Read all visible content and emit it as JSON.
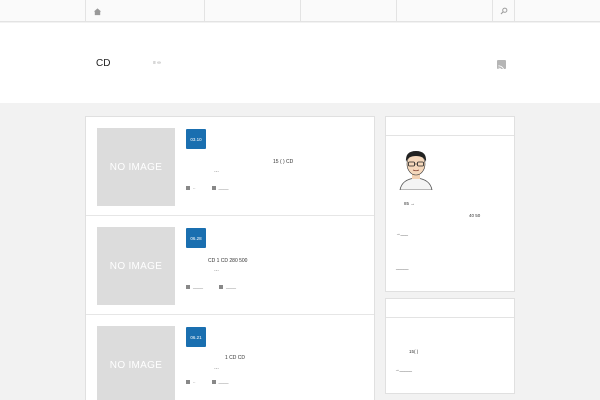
{
  "nav": {
    "home_icon": "home-icon",
    "search_icon": "search-icon"
  },
  "header": {
    "site_title": "CD",
    "links": "≡ ∞",
    "rss_icon": "rss-icon"
  },
  "posts": [
    {
      "date": "03.10",
      "thumb_label": "NO IMAGE",
      "excerpt_line1": "15 ( )                CD",
      "excerpt_line2": "…",
      "meta_cat": "..",
      "meta_comments": "____"
    },
    {
      "date": "06.28",
      "thumb_label": "NO IMAGE",
      "excerpt_line1": "CD              1              CD              280 500",
      "excerpt_line2": "…",
      "meta_cat": "____",
      "meta_comments": "____"
    },
    {
      "date": "06.21",
      "thumb_label": "NO IMAGE",
      "excerpt_line1": "1    CD              CD",
      "excerpt_line2": "…",
      "meta_cat": "..",
      "meta_comments": "____"
    }
  ],
  "sidebar": {
    "profile": {
      "line1": "85      →",
      "line2": "40 50",
      "link1": "→___",
      "link2": "_____"
    },
    "widget2": {
      "line1": "15(  )",
      "link1": "→_____"
    }
  }
}
